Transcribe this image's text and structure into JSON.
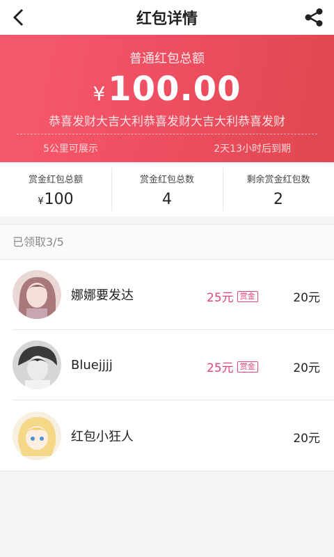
{
  "header": {
    "title": "红包详情",
    "back_icon": "back-arrow-icon",
    "share_icon": "share-icon"
  },
  "hero": {
    "label": "普通红包总额",
    "currency": "¥",
    "amount": "100.00",
    "blessing": "恭喜发财大吉大利恭喜发财大吉大利恭喜发财",
    "range": "5公里可展示",
    "expire": "2天13小时后到期",
    "colors": {
      "start": "#f6596d",
      "end": "#e0474f"
    }
  },
  "stats": [
    {
      "label": "赏金红包总额",
      "prefix": "¥",
      "value": "100"
    },
    {
      "label": "赏金红包总数",
      "prefix": "",
      "value": "4"
    },
    {
      "label": "剩余赏金红包数",
      "prefix": "",
      "value": "2"
    }
  ],
  "received": {
    "title": "已领取3/5"
  },
  "list": [
    {
      "name": "娜娜要发达",
      "bonus": "25元",
      "tag": "赏金",
      "total": "20元"
    },
    {
      "name": "Bluejjjj",
      "bonus": "25元",
      "tag": "赏金",
      "total": "20元"
    },
    {
      "name": "红包小狂人",
      "bonus": "",
      "tag": "",
      "total": "20元"
    }
  ]
}
